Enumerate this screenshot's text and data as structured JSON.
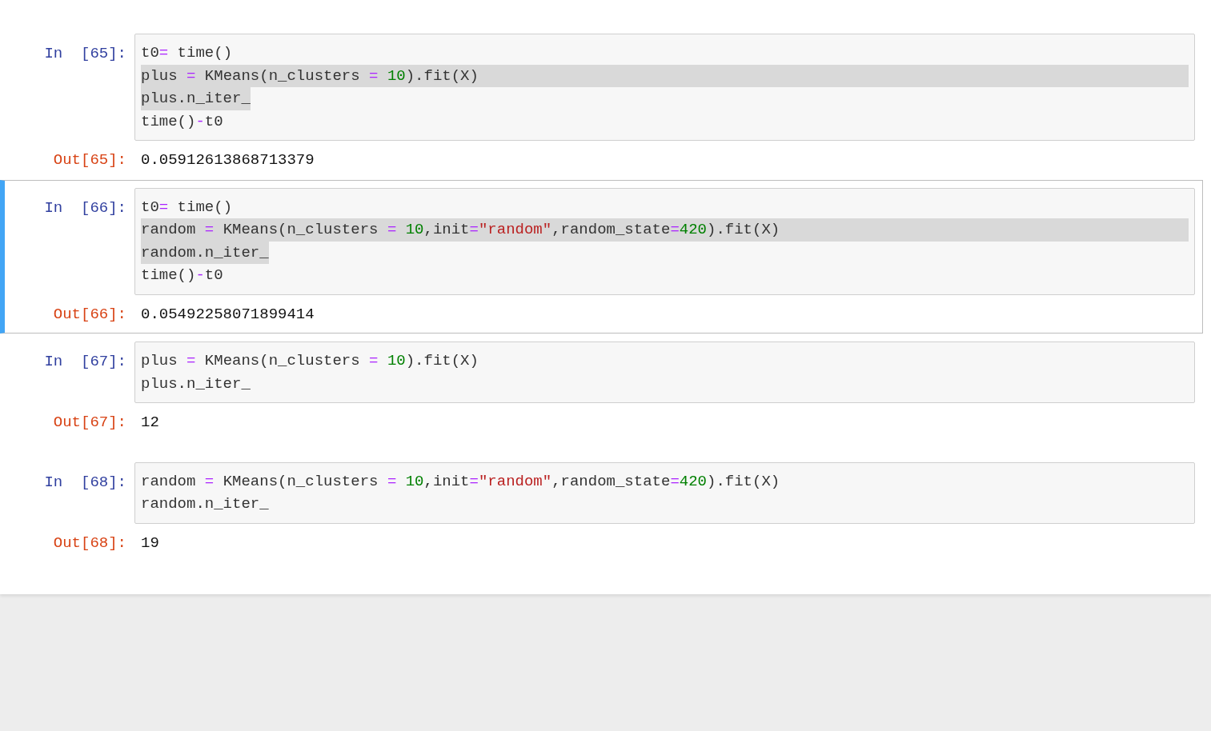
{
  "cells": [
    {
      "prompt_in": "In  [65]:",
      "prompt_out": "Out[65]:",
      "selected": false,
      "output": "0.05912613868713379",
      "lines": [
        {
          "selected": false,
          "tokens": [
            {
              "kind": "plain",
              "text": "t0"
            },
            {
              "kind": "op",
              "text": "="
            },
            {
              "kind": "plain",
              "text": " time()"
            }
          ]
        },
        {
          "selected": true,
          "tokens": [
            {
              "kind": "plain",
              "text": "plus "
            },
            {
              "kind": "op",
              "text": "="
            },
            {
              "kind": "plain",
              "text": " KMeans(n_clusters "
            },
            {
              "kind": "op",
              "text": "= "
            },
            {
              "kind": "number",
              "text": "10"
            },
            {
              "kind": "plain",
              "text": ").fit(X)"
            }
          ]
        },
        {
          "selected": true,
          "tokens": [
            {
              "kind": "plain",
              "text": "plus.n_iter_"
            }
          ]
        },
        {
          "selected": false,
          "tokens": [
            {
              "kind": "plain",
              "text": "time()"
            },
            {
              "kind": "op",
              "text": "-"
            },
            {
              "kind": "plain",
              "text": "t0"
            }
          ]
        }
      ]
    },
    {
      "prompt_in": "In  [66]:",
      "prompt_out": "Out[66]:",
      "selected": true,
      "output": "0.05492258071899414",
      "lines": [
        {
          "selected": false,
          "tokens": [
            {
              "kind": "plain",
              "text": "t0"
            },
            {
              "kind": "op",
              "text": "="
            },
            {
              "kind": "plain",
              "text": " time()"
            }
          ]
        },
        {
          "selected": true,
          "tokens": [
            {
              "kind": "plain",
              "text": "random "
            },
            {
              "kind": "op",
              "text": "="
            },
            {
              "kind": "plain",
              "text": " KMeans(n_clusters "
            },
            {
              "kind": "op",
              "text": "= "
            },
            {
              "kind": "number",
              "text": "10"
            },
            {
              "kind": "plain",
              "text": ",init"
            },
            {
              "kind": "op",
              "text": "="
            },
            {
              "kind": "string",
              "text": "\"random\""
            },
            {
              "kind": "plain",
              "text": ",random_state"
            },
            {
              "kind": "op",
              "text": "="
            },
            {
              "kind": "number",
              "text": "420"
            },
            {
              "kind": "plain",
              "text": ").fit(X)"
            }
          ]
        },
        {
          "selected": true,
          "tokens": [
            {
              "kind": "plain",
              "text": "random.n_iter_"
            }
          ]
        },
        {
          "selected": false,
          "tokens": [
            {
              "kind": "plain",
              "text": "time()"
            },
            {
              "kind": "op",
              "text": "-"
            },
            {
              "kind": "plain",
              "text": "t0"
            }
          ]
        }
      ]
    },
    {
      "prompt_in": "In  [67]:",
      "prompt_out": "Out[67]:",
      "selected": false,
      "output": "12",
      "lines": [
        {
          "selected": false,
          "tokens": [
            {
              "kind": "plain",
              "text": "plus "
            },
            {
              "kind": "op",
              "text": "="
            },
            {
              "kind": "plain",
              "text": " KMeans(n_clusters "
            },
            {
              "kind": "op",
              "text": "= "
            },
            {
              "kind": "number",
              "text": "10"
            },
            {
              "kind": "plain",
              "text": ").fit(X)"
            }
          ]
        },
        {
          "selected": false,
          "tokens": [
            {
              "kind": "plain",
              "text": "plus.n_iter_"
            }
          ]
        }
      ]
    },
    {
      "prompt_in": "In  [68]:",
      "prompt_out": "Out[68]:",
      "selected": false,
      "output": "19",
      "lines": [
        {
          "selected": false,
          "tokens": [
            {
              "kind": "plain",
              "text": "random "
            },
            {
              "kind": "op",
              "text": "="
            },
            {
              "kind": "plain",
              "text": " KMeans(n_clusters "
            },
            {
              "kind": "op",
              "text": "= "
            },
            {
              "kind": "number",
              "text": "10"
            },
            {
              "kind": "plain",
              "text": ",init"
            },
            {
              "kind": "op",
              "text": "="
            },
            {
              "kind": "string",
              "text": "\"random\""
            },
            {
              "kind": "plain",
              "text": ",random_state"
            },
            {
              "kind": "op",
              "text": "="
            },
            {
              "kind": "number",
              "text": "420"
            },
            {
              "kind": "plain",
              "text": ").fit(X)"
            }
          ]
        },
        {
          "selected": false,
          "tokens": [
            {
              "kind": "plain",
              "text": "random.n_iter_"
            }
          ]
        }
      ]
    }
  ]
}
